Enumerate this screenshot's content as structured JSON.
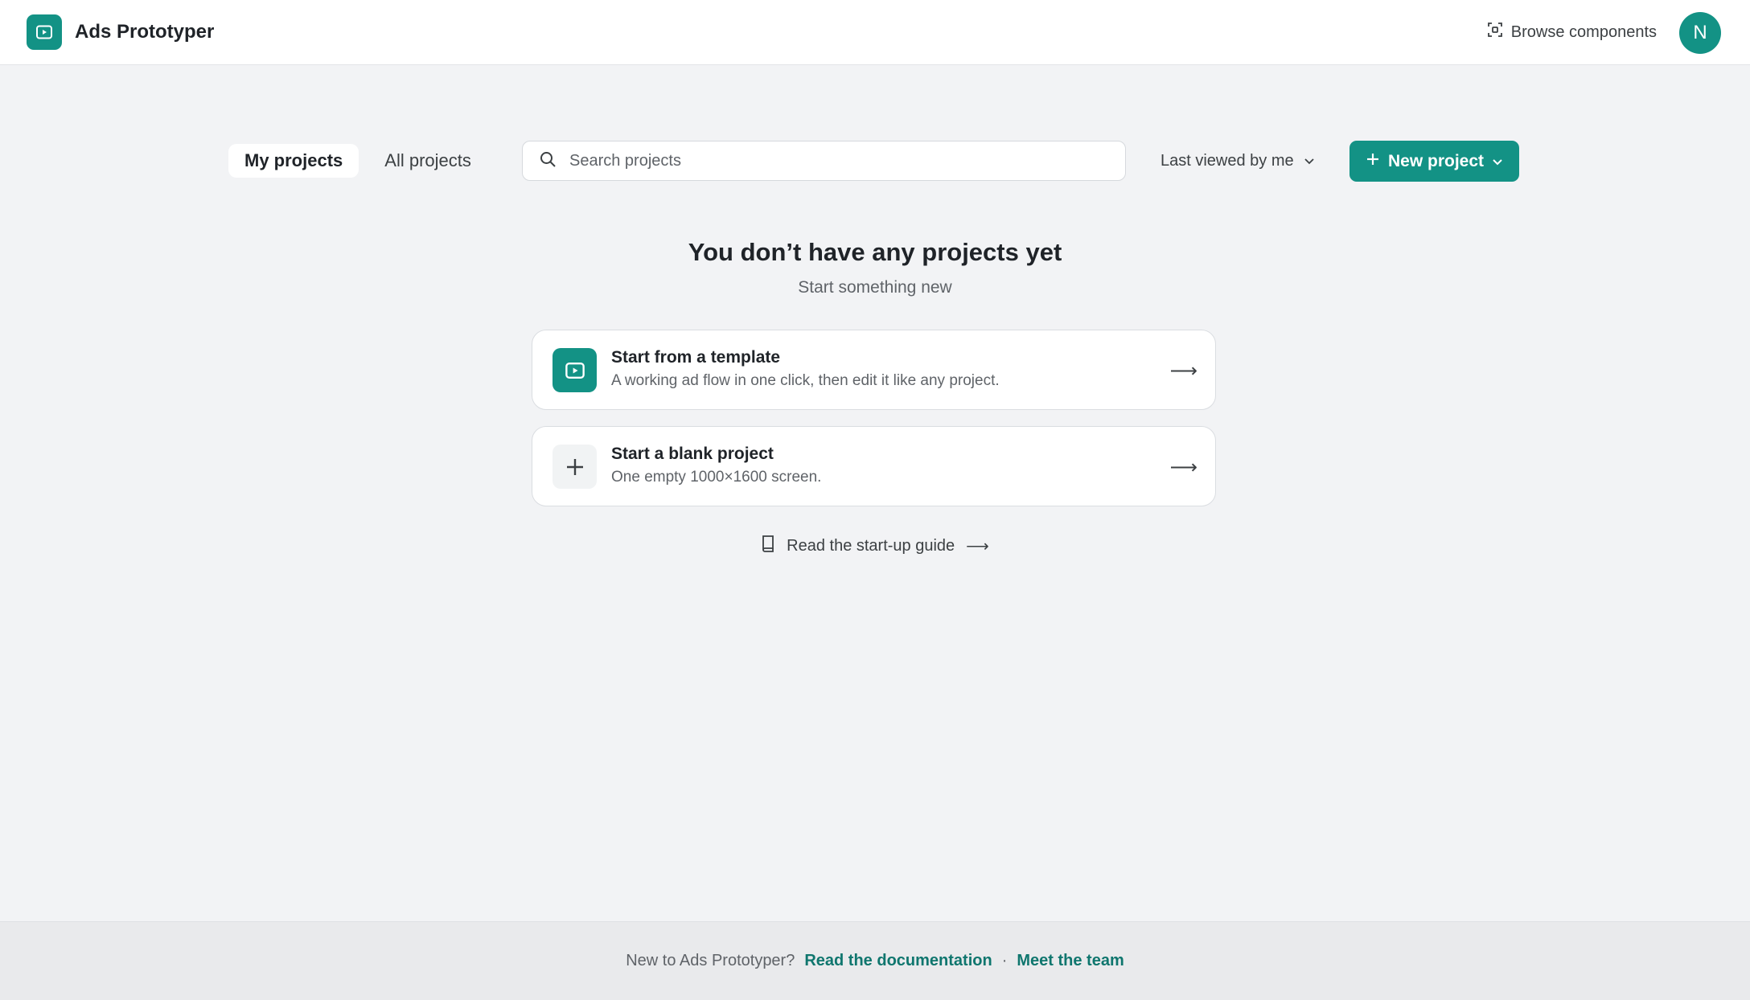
{
  "app": {
    "title": "Ads Prototyper",
    "accent": "#139285"
  },
  "header": {
    "browse_label": "Browse components",
    "avatar_initial": "N"
  },
  "tabs": [
    {
      "label": "My projects",
      "active": true
    },
    {
      "label": "All projects",
      "active": false
    }
  ],
  "search": {
    "placeholder": "Search projects",
    "value": ""
  },
  "sort": {
    "label": "Last viewed by me"
  },
  "new_project": {
    "label": "New project"
  },
  "empty_state": {
    "title": "You don’t have any projects yet",
    "subtitle": "Start something new"
  },
  "cards": [
    {
      "title": "Start from a template",
      "subtitle": "A working ad flow in one click, then edit it like any project.",
      "icon": "play-screen-icon"
    },
    {
      "title": "Start a blank project",
      "subtitle": "One empty 1000×1600 screen.",
      "icon": "plus-icon"
    }
  ],
  "guide": {
    "label": "Read the start-up guide"
  },
  "footer": {
    "prompt": "New to Ads Prototyper?",
    "docs_link": "Read the documentation",
    "separator": "·",
    "team_link": "Meet the team"
  }
}
